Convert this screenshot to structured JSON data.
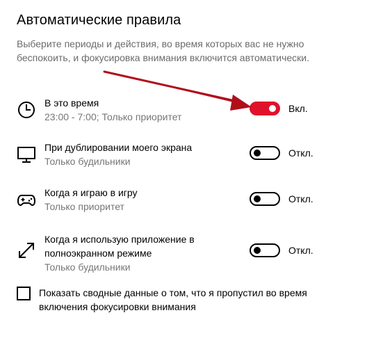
{
  "section": {
    "title": "Автоматические правила",
    "description": "Выберите периоды и действия, во время которых вас не нужно беспокоить, и фокусировка внимания включится автоматически."
  },
  "rules": [
    {
      "icon": "clock-icon",
      "title": "В это время",
      "subtitle": "23:00 - 7:00; Только приоритет",
      "toggle_on": true,
      "state_label": "Вкл."
    },
    {
      "icon": "monitor-icon",
      "title": "При дублировании моего экрана",
      "subtitle": "Только будильники",
      "toggle_on": false,
      "state_label": "Откл."
    },
    {
      "icon": "gamepad-icon",
      "title": "Когда я играю в игру",
      "subtitle": "Только приоритет",
      "toggle_on": false,
      "state_label": "Откл."
    },
    {
      "icon": "fullscreen-arrows-icon",
      "title": "Когда я использую приложение в полноэкранном режиме",
      "subtitle": "Только будильники",
      "toggle_on": false,
      "state_label": "Откл."
    }
  ],
  "summary_checkbox": {
    "checked": false,
    "label": "Показать сводные данные о том, что я пропустил во время включения фокусировки внимания"
  },
  "colors": {
    "toggle_on": "#e0112b",
    "annotation_arrow": "#b00f1a",
    "secondary_text": "#767676"
  }
}
